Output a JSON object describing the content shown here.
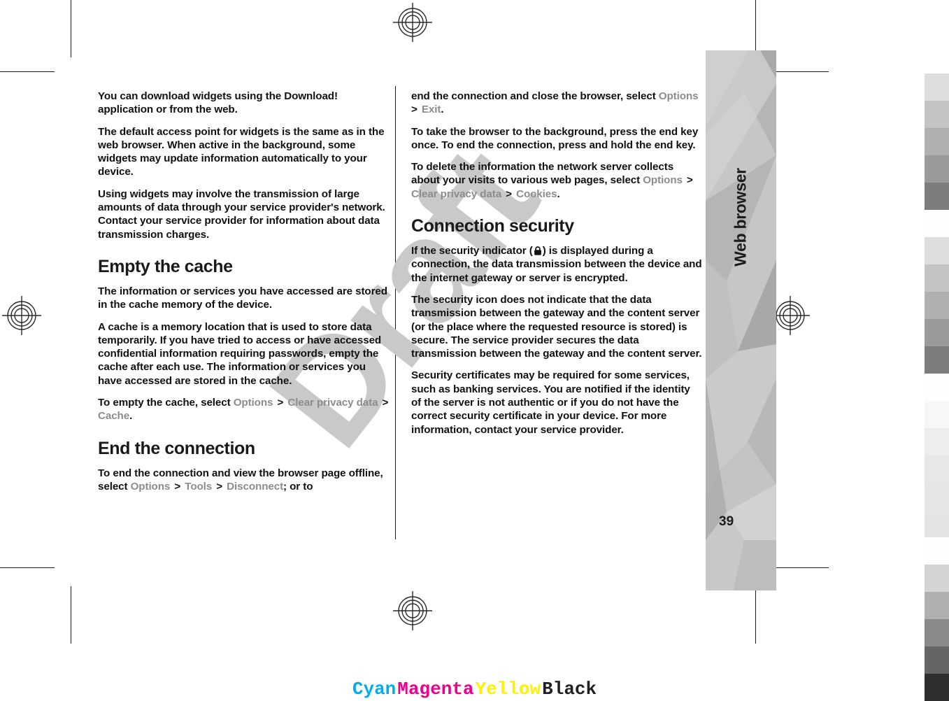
{
  "document": {
    "chapter_tab_label": "Web browser",
    "page_number": "39",
    "watermark": "Draft"
  },
  "left_column": {
    "paragraphs": [
      {
        "id": "p-widgets-download",
        "type": "paragraph",
        "text": "You can download widgets using the Download! application or from the web."
      },
      {
        "id": "p-widgets-access-point",
        "type": "paragraph",
        "text": "The default access point for widgets is the same as in the web browser. When active in the background, some widgets may update information automatically to your device."
      },
      {
        "id": "p-widgets-transmission",
        "type": "paragraph",
        "text": "Using widgets may involve the transmission of large amounts of data through your service provider's network. Contact your service provider for information about data transmission charges."
      },
      {
        "id": "h-empty-the-cache",
        "type": "heading",
        "text": "Empty the cache"
      },
      {
        "id": "p-cache-stored",
        "type": "paragraph",
        "text": "The information or services you have accessed are stored in the cache memory of the device."
      },
      {
        "id": "p-cache-definition",
        "type": "paragraph",
        "text": "A cache is a memory location that is used to store data temporarily. If you have tried to access or have accessed confidential information requiring passwords, empty the cache after each use. The information or services you have accessed are stored in the cache."
      },
      {
        "id": "p-empty-cache-steps",
        "type": "menu-paragraph",
        "lead": "To empty the cache, select ",
        "path": [
          "Options",
          "Clear privacy data",
          "Cache"
        ],
        "separator": ">",
        "trail": "."
      },
      {
        "id": "h-end-the-connection",
        "type": "heading",
        "text": "End the connection"
      },
      {
        "id": "p-disconnect-steps",
        "type": "menu-paragraph",
        "lead": "To end the connection and view the browser page offline, select ",
        "path": [
          "Options",
          "Tools",
          "Disconnect"
        ],
        "separator": ">",
        "trail": "; or to"
      }
    ]
  },
  "right_column": {
    "paragraphs": [
      {
        "id": "p-exit-steps",
        "type": "menu-paragraph",
        "lead": "end the connection and close the browser, select ",
        "path": [
          "Options",
          "Exit"
        ],
        "separator": ">",
        "trail": "."
      },
      {
        "id": "p-background-end-key",
        "type": "paragraph",
        "text": "To take the browser to the background, press the end key once. To end the connection, press and hold the end key."
      },
      {
        "id": "p-clear-cookies-steps",
        "type": "menu-paragraph",
        "lead": "To delete the information the network server collects about your visits to various web pages, select ",
        "path": [
          "Options",
          "Clear privacy data",
          "Cookies"
        ],
        "separator": ">",
        "trail": "."
      },
      {
        "id": "h-connection-security",
        "type": "heading",
        "text": "Connection security"
      },
      {
        "id": "p-security-indicator",
        "type": "icon-paragraph",
        "lead": "If the security indicator (",
        "icon": "padlock-icon",
        "trail": ") is displayed during a connection, the data transmission between the device and the internet gateway or server is encrypted."
      },
      {
        "id": "p-security-icon-scope",
        "type": "paragraph",
        "text": "The security icon does not indicate that the data transmission between the gateway and the content server (or the place where the requested resource is stored) is secure. The service provider secures the data transmission between the gateway and the content server."
      },
      {
        "id": "p-security-certificates",
        "type": "paragraph",
        "text": "Security certificates may be required for some services, such as banking services. You are notified if the identity of the server is not authentic or if you do not have the correct security certificate in your device. For more information, contact your service provider."
      }
    ]
  },
  "print_marks": {
    "color_legend": [
      {
        "label": "Cyan",
        "color": "#00aeef"
      },
      {
        "label": "Magenta",
        "color": "#ec008c"
      },
      {
        "label": "Yellow",
        "color": "#fff200"
      },
      {
        "label": "Black",
        "color": "#231f20"
      }
    ],
    "gray_wedge": [
      "#ffffff",
      "#dedede",
      "#c4c4c4",
      "#b0b0b0",
      "#9a9a9a",
      "#7d7d7d",
      "#fdfdfd",
      "#dedede",
      "#c4c4c4",
      "#b0b0b0",
      "#9a9a9a",
      "#7d7d7d",
      "#fdfdfd",
      "#f7f7f7",
      "#ededed",
      "#e7e7e7",
      "#e5e5e5",
      "#e4e4e4",
      "#fdfdfd",
      "#d4d4d4",
      "#b0b0b0",
      "#8a8a8a",
      "#656565",
      "#2e2e2e"
    ]
  }
}
